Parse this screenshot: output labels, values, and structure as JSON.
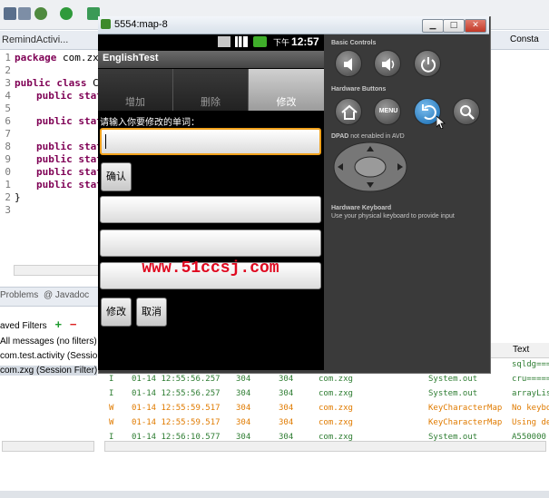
{
  "eclipse": {
    "editor_tab": "RemindActivi... ",
    "code_lines": [
      {
        "n": "1",
        "kw": "package",
        "text": " com.zxg"
      },
      {
        "n": "2",
        "kw": "",
        "text": ""
      },
      {
        "n": "3",
        "kw": "public class",
        "text": " Co"
      },
      {
        "n": "4",
        "kw": "public stat",
        "text": ""
      },
      {
        "n": "5",
        "kw": "",
        "text": ""
      },
      {
        "n": "6",
        "kw": "public stat",
        "text": ""
      },
      {
        "n": "7",
        "kw": "",
        "text": ""
      },
      {
        "n": "8",
        "kw": "public stat",
        "text": ""
      },
      {
        "n": "9",
        "kw": "public stat",
        "text": ""
      },
      {
        "n": "0",
        "kw": "public stat",
        "text": ""
      },
      {
        "n": "1",
        "kw": "public stat",
        "text": ""
      },
      {
        "n": "2",
        "kw": "",
        "text": "}"
      },
      {
        "n": "3",
        "kw": "",
        "text": ""
      }
    ],
    "bottom_tabs": {
      "problems": "Problems",
      "javadoc": "@ Javadoc"
    },
    "saved_filters_title": "aved Filters",
    "filters": [
      "All messages (no filters)",
      "com.test.activity (Sessio",
      "com.zxg (Session Filter)"
    ],
    "right_tab": "Consta",
    "text_column": "Text",
    "log_rows": [
      {
        "level": "",
        "date": "",
        "pid": "",
        "tid": "",
        "app": "",
        "tag": "",
        "text": "sqldg===",
        "color": "#2e7d32"
      },
      {
        "level": "I",
        "date": "01-14 12:55:56.257",
        "pid": "304",
        "tid": "304",
        "app": "com.zxg",
        "tag": "System.out",
        "text": "cru=====",
        "color": "#2e7d32"
      },
      {
        "level": "I",
        "date": "01-14 12:55:56.257",
        "pid": "304",
        "tid": "304",
        "app": "com.zxg",
        "tag": "System.out",
        "text": "arrayLis",
        "color": "#2e7d32"
      },
      {
        "level": "W",
        "date": "01-14 12:55:59.517",
        "pid": "304",
        "tid": "304",
        "app": "com.zxg",
        "tag": "KeyCharacterMap",
        "text": "No keybo",
        "color": "#e07b00"
      },
      {
        "level": "W",
        "date": "01-14 12:55:59.517",
        "pid": "304",
        "tid": "304",
        "app": "com.zxg",
        "tag": "KeyCharacterMap",
        "text": "Using de",
        "color": "#e07b00"
      },
      {
        "level": "I",
        "date": "01-14 12:56:10.577",
        "pid": "304",
        "tid": "304",
        "app": "com.zxg",
        "tag": "System.out",
        "text": "A550000",
        "color": "#2e7d32"
      }
    ]
  },
  "emulator": {
    "window_title": "5554:map-8",
    "clock_prefix": "下午",
    "clock_time": "12:57",
    "app_title": "EnglishTest",
    "tabs": [
      "增加",
      "删除",
      "修改"
    ],
    "active_tab_index": 2,
    "prompt": "请输入你要修改的单词：",
    "confirm_button": "确认",
    "watermark": "www.51ccsj.com",
    "modify_button": "修改",
    "cancel_button": "取消",
    "panel": {
      "basic_controls": "Basic Controls",
      "hardware_buttons": "Hardware Buttons",
      "menu_label": "MENU",
      "dpad_label": "DPAD",
      "dpad_note": " not enabled in AVD",
      "keyboard_title": "Hardware Keyboard",
      "keyboard_note": "Use your physical keyboard to provide input"
    }
  }
}
